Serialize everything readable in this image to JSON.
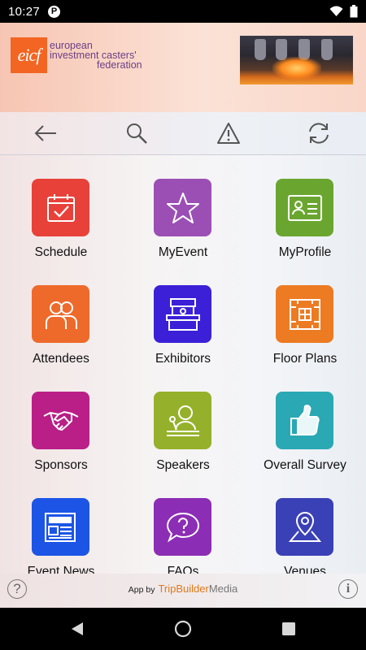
{
  "status_bar": {
    "time": "10:27",
    "notification_icon": "P"
  },
  "header": {
    "logo_mark": "eicf",
    "logo_lines": [
      "european",
      "investment casters'",
      "federation"
    ]
  },
  "toolbar": {
    "back": "back-arrow-icon",
    "search": "search-icon",
    "alert": "warning-icon",
    "sync": "sync-icon"
  },
  "tiles": [
    {
      "label": "Schedule",
      "color": "#e8413a",
      "icon": "calendar-check-icon"
    },
    {
      "label": "MyEvent",
      "color": "#9b4fb5",
      "icon": "star-icon"
    },
    {
      "label": "MyProfile",
      "color": "#6aa62f",
      "icon": "id-card-icon"
    },
    {
      "label": "Attendees",
      "color": "#ee6a2b",
      "icon": "people-icon"
    },
    {
      "label": "Exhibitors",
      "color": "#3b20d8",
      "icon": "booth-icon"
    },
    {
      "label": "Floor Plans",
      "color": "#ec7b22",
      "icon": "floor-plan-icon"
    },
    {
      "label": "Sponsors",
      "color": "#b91f87",
      "icon": "handshake-icon"
    },
    {
      "label": "Speakers",
      "color": "#95b12b",
      "icon": "speaker-icon"
    },
    {
      "label": "Overall Survey",
      "color": "#2aa8b4",
      "icon": "thumbs-up-icon"
    },
    {
      "label": "Event News",
      "color": "#1c55e6",
      "icon": "newspaper-icon"
    },
    {
      "label": "FAQs",
      "color": "#8c2db5",
      "icon": "question-bubble-icon"
    },
    {
      "label": "Venues",
      "color": "#3a40b6",
      "icon": "location-pin-icon"
    }
  ],
  "footer": {
    "app_by": "App by",
    "brand_a": "TripBuilder",
    "brand_b": "Media",
    "help": "?",
    "info": "i"
  }
}
